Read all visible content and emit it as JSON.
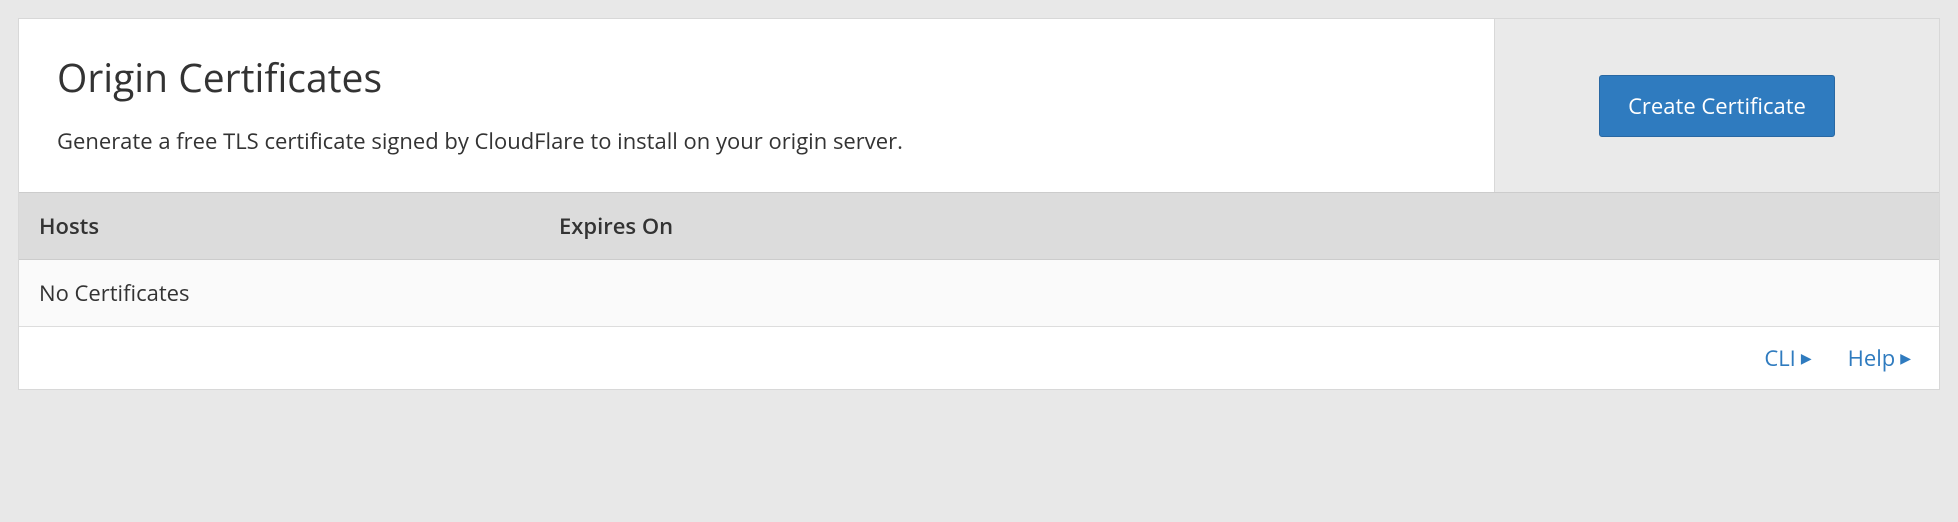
{
  "header": {
    "title": "Origin Certificates",
    "description": "Generate a free TLS certificate signed by CloudFlare to install on your origin server.",
    "create_button": "Create Certificate"
  },
  "table": {
    "columns": {
      "hosts": "Hosts",
      "expires_on": "Expires On"
    },
    "empty": "No Certificates"
  },
  "footer": {
    "cli": "CLI",
    "help": "Help"
  }
}
